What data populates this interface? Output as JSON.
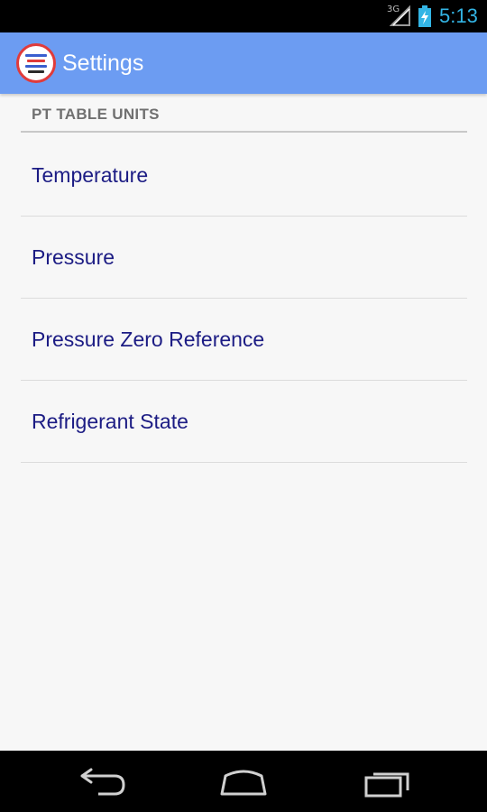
{
  "status_bar": {
    "network_type": "3G",
    "time": "5:13",
    "accent_color": "#33b5e5"
  },
  "action_bar": {
    "title": "Settings",
    "background_color": "#6c9cf2",
    "icon": "app-logo-icon"
  },
  "settings": {
    "section_header": "PT TABLE UNITS",
    "items": [
      {
        "label": "Temperature"
      },
      {
        "label": "Pressure"
      },
      {
        "label": "Pressure Zero Reference"
      },
      {
        "label": "Refrigerant State"
      }
    ]
  },
  "nav_bar": {
    "buttons": [
      {
        "icon": "back-icon"
      },
      {
        "icon": "home-icon"
      },
      {
        "icon": "recent-apps-icon"
      }
    ]
  }
}
